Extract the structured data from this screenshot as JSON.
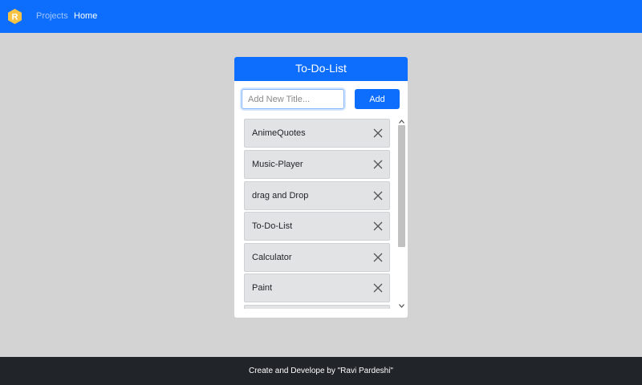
{
  "navbar": {
    "logo_letter": "R",
    "links": [
      {
        "label": "Projects"
      },
      {
        "label": "Home"
      }
    ]
  },
  "card": {
    "title": "To-Do-List",
    "input": {
      "placeholder": "Add New Title...",
      "value": ""
    },
    "add_label": "Add",
    "items": [
      {
        "label": "AnimeQuotes"
      },
      {
        "label": "Music-Player"
      },
      {
        "label": "drag and Drop"
      },
      {
        "label": "To-Do-List"
      },
      {
        "label": "Calculator"
      },
      {
        "label": "Paint"
      },
      {
        "label": ""
      }
    ]
  },
  "footer": {
    "text": "Create and Develope by \"Ravi Pardeshi\""
  },
  "colors": {
    "primary": "#0d6efd",
    "page_bg": "#d3d3d3",
    "footer_bg": "#212529",
    "item_bg": "#e2e3e5",
    "logo_fill": "#f6c344"
  },
  "icons": {
    "logo": "hexagon-r-logo",
    "item_remove": "close-icon",
    "scroll_up": "chevron-up-icon",
    "scroll_down": "chevron-down-icon"
  }
}
